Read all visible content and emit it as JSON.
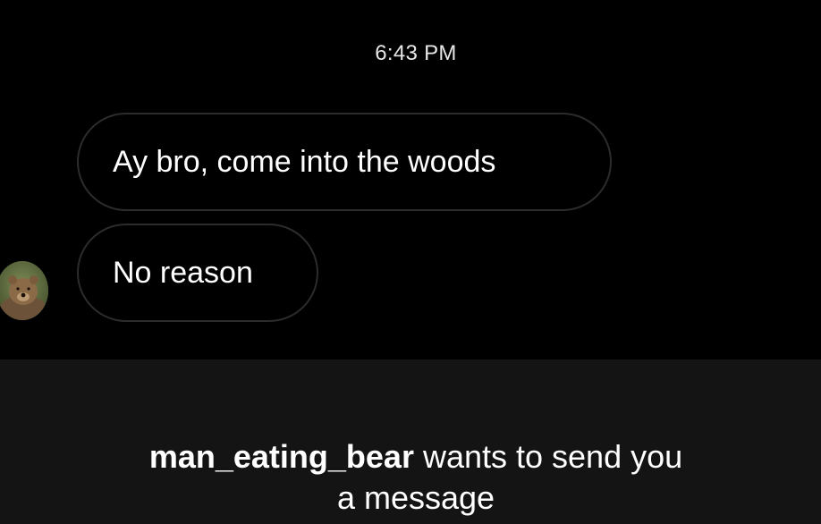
{
  "chat": {
    "timestamp": "6:43 PM",
    "messages": [
      {
        "text": "Ay bro, come into the woods"
      },
      {
        "text": "No reason"
      }
    ],
    "avatar_icon": "bear-avatar"
  },
  "request": {
    "username": "man_eating_bear",
    "text_line1": "wants to send you",
    "text_line2": "a message"
  }
}
